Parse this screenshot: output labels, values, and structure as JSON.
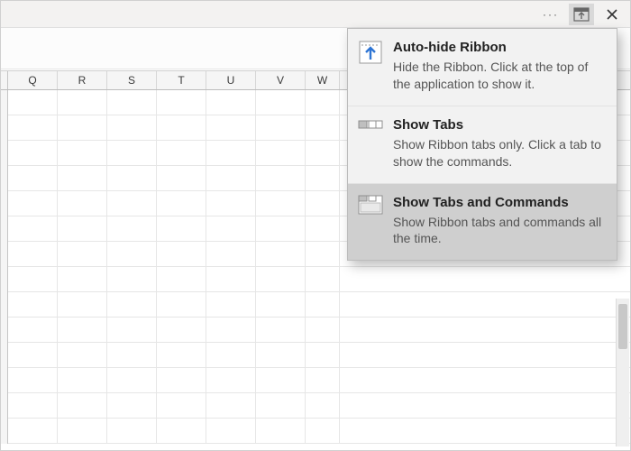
{
  "columns": [
    "Q",
    "R",
    "S",
    "T",
    "U",
    "V",
    "W"
  ],
  "row_count": 14,
  "menu": {
    "items": [
      {
        "icon": "auto-hide",
        "title": "Auto-hide Ribbon",
        "desc": "Hide the Ribbon. Click at the top of the application to show it.",
        "selected": false
      },
      {
        "icon": "show-tabs",
        "title": "Show Tabs",
        "desc": "Show Ribbon tabs only. Click a tab to show the commands.",
        "selected": false
      },
      {
        "icon": "show-tabs-commands",
        "title": "Show Tabs and Commands",
        "desc": "Show Ribbon tabs and commands all the time.",
        "selected": true
      }
    ]
  },
  "titlebar": {
    "ellipsis": "···"
  }
}
